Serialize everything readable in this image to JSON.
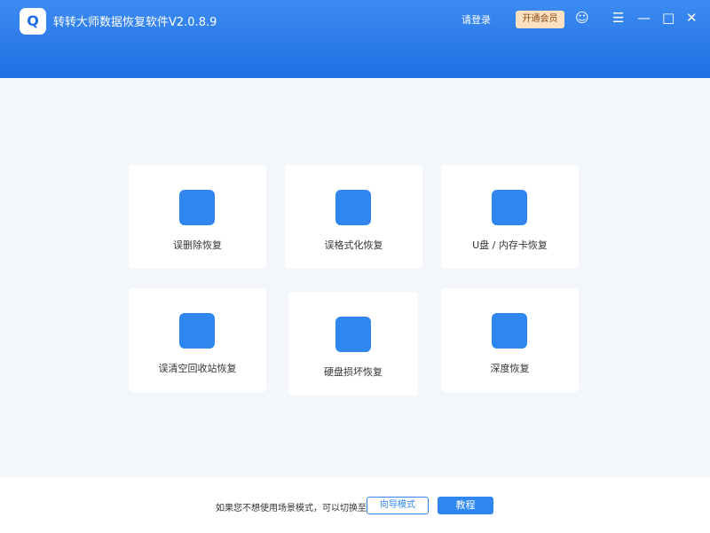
{
  "app": {
    "title": "转转大师数据恢复软件V2.0.8.9",
    "login": "请登录",
    "vip": "开通会员"
  },
  "cards": [
    "误删除恢复",
    "误格式化恢复",
    "U盘 / 内存卡恢复",
    "误清空回收站恢复",
    "硬盘损坏恢复",
    "深度恢复"
  ],
  "footer": {
    "text": "如果您不想使用场景模式，可以切换至",
    "guide": "向导模式",
    "tutorial": "教程"
  }
}
